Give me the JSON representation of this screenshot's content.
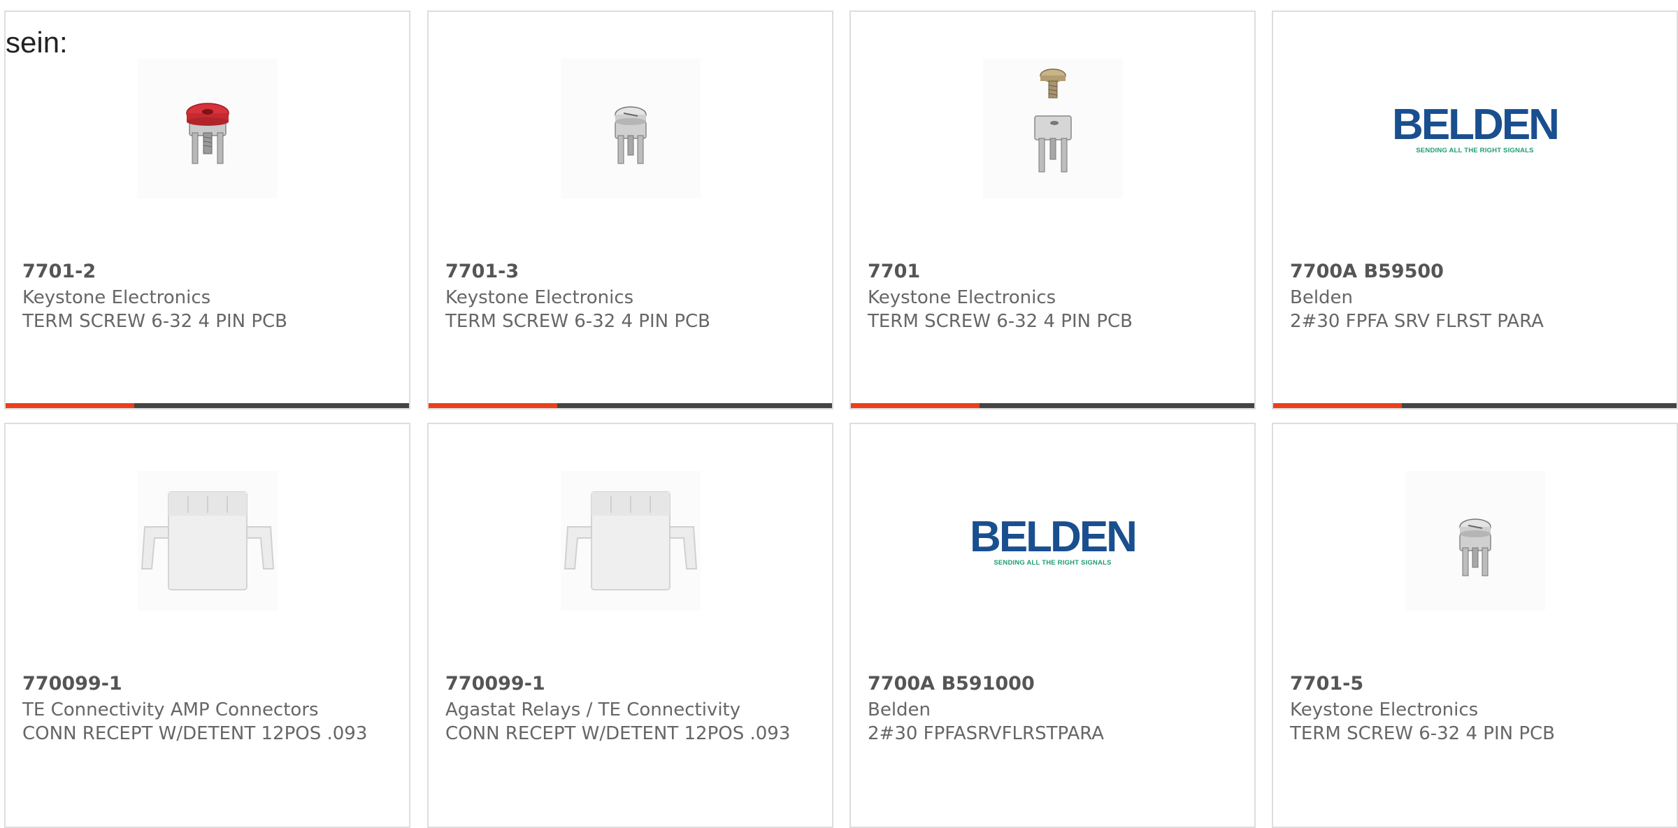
{
  "intro_text": "sein:",
  "colors": {
    "accent_bar": "#e8401a",
    "bar_track": "#444444",
    "belden_blue": "#1a4f8f",
    "belden_green": "#1e9d6e"
  },
  "products": [
    {
      "part_number": "7701-2",
      "manufacturer": "Keystone Electronics",
      "description": "TERM SCREW 6-32 4 PIN PCB",
      "image": "screw-terminal-red-icon"
    },
    {
      "part_number": "7701-3",
      "manufacturer": "Keystone Electronics",
      "description": "TERM SCREW 6-32 4 PIN PCB",
      "image": "screw-terminal-icon"
    },
    {
      "part_number": "7701",
      "manufacturer": "Keystone Electronics",
      "description": "TERM SCREW 6-32 4 PIN PCB",
      "image": "screw-terminal-separated-icon"
    },
    {
      "part_number": "7700A B59500",
      "manufacturer": "Belden",
      "description": "2#30 FPFA SRV FLRST PARA",
      "image": "belden-logo",
      "logo_text": "BELDEN",
      "logo_tagline": "SENDING ALL THE RIGHT SIGNALS"
    },
    {
      "part_number": "770099-1",
      "manufacturer": "TE Connectivity AMP Connectors",
      "description": "CONN RECEPT W/DETENT 12POS .093",
      "image": "connector-housing-icon"
    },
    {
      "part_number": "770099-1",
      "manufacturer": "Agastat Relays / TE Connectivity",
      "description": "CONN RECEPT W/DETENT 12POS .093",
      "image": "connector-housing-icon"
    },
    {
      "part_number": "7700A B591000",
      "manufacturer": "Belden",
      "description": "2#30 FPFASRVFLRSTPARA",
      "image": "belden-logo",
      "logo_text": "BELDEN",
      "logo_tagline": "SENDING ALL THE RIGHT SIGNALS"
    },
    {
      "part_number": "7701-5",
      "manufacturer": "Keystone Electronics",
      "description": "TERM SCREW 6-32 4 PIN PCB",
      "image": "screw-terminal-icon"
    }
  ]
}
